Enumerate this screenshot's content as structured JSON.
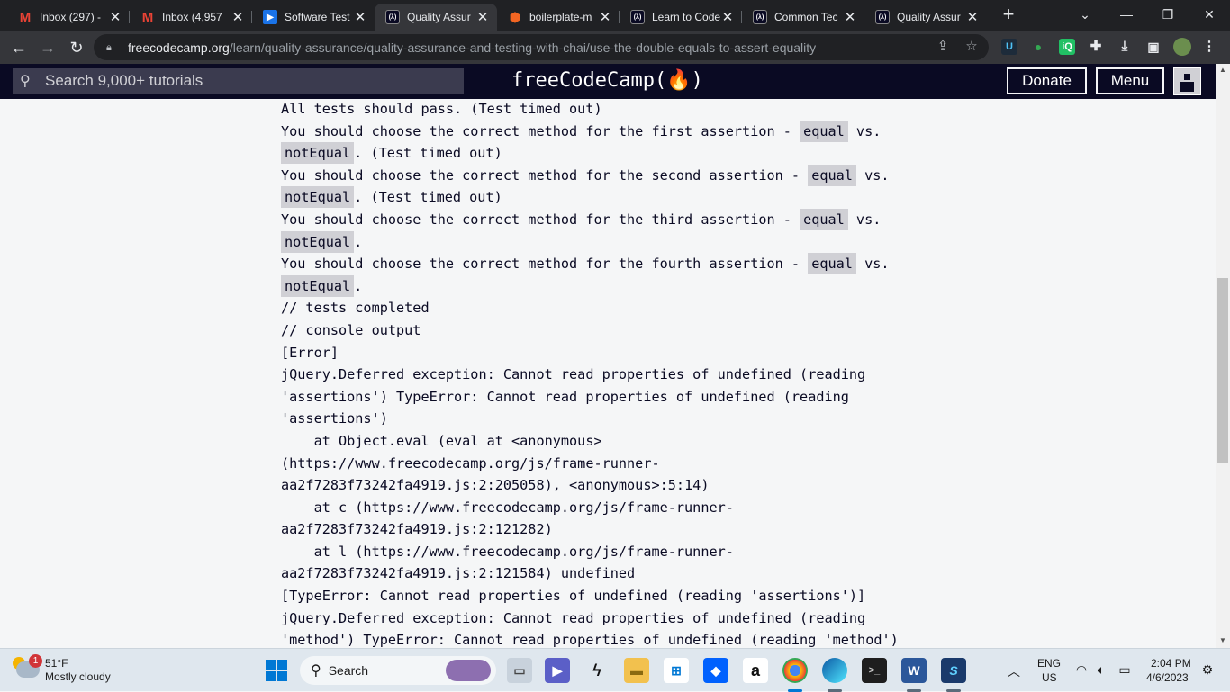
{
  "browser": {
    "tabs": [
      {
        "title": "Inbox (297) - ",
        "favicon": "gmail-icon",
        "active": false
      },
      {
        "title": "Inbox (4,957",
        "favicon": "gmail-icon",
        "active": false
      },
      {
        "title": "Software Test",
        "favicon": "youtube-icon",
        "active": false
      },
      {
        "title": "Quality Assur",
        "favicon": "freecodecamp-icon",
        "active": true
      },
      {
        "title": "boilerplate-m",
        "favicon": "boilerplate-icon",
        "active": false
      },
      {
        "title": "Learn to Code",
        "favicon": "freecodecamp-icon",
        "active": false
      },
      {
        "title": "Common Tec",
        "favicon": "freecodecamp-icon",
        "active": false
      },
      {
        "title": "Quality Assur",
        "favicon": "freecodecamp-icon",
        "active": false
      }
    ],
    "url_domain": "freecodecamp.org",
    "url_path": "/learn/quality-assurance/quality-assurance-and-testing-with-chai/use-the-double-equals-to-assert-equality"
  },
  "fcc_nav": {
    "search_placeholder": "Search 9,000+ tutorials",
    "logo": "freeCodeCamp(🔥)",
    "donate_label": "Donate",
    "menu_label": "Menu"
  },
  "console_lines": [
    {
      "text": "All tests should pass. (Test timed out)"
    },
    {
      "text": "You should choose the correct method for the first assertion - ",
      "code1": "equal",
      "tail": " vs."
    },
    {
      "code1": "notEqual",
      "tail": ". (Test timed out)"
    },
    {
      "text": "You should choose the correct method for the second assertion - ",
      "code1": "equal",
      "tail": " vs."
    },
    {
      "code1": "notEqual",
      "tail": ". (Test timed out)"
    },
    {
      "text": "You should choose the correct method for the third assertion - ",
      "code1": "equal",
      "tail": " vs."
    },
    {
      "code1": "notEqual",
      "tail": "."
    },
    {
      "text": "You should choose the correct method for the fourth assertion - ",
      "code1": "equal",
      "tail": " vs."
    },
    {
      "code1": "notEqual",
      "tail": "."
    },
    {
      "text": "// tests completed"
    },
    {
      "text": "// console output"
    },
    {
      "text": "[Error]"
    },
    {
      "text": "jQuery.Deferred exception: Cannot read properties of undefined (reading"
    },
    {
      "text": "'assertions') TypeError: Cannot read properties of undefined (reading"
    },
    {
      "text": "'assertions')"
    },
    {
      "text": "    at Object.eval (eval at <anonymous>"
    },
    {
      "text": "(https://www.freecodecamp.org/js/frame-runner-"
    },
    {
      "text": "aa2f7283f73242fa4919.js:2:205058), <anonymous>:5:14)"
    },
    {
      "text": "    at c (https://www.freecodecamp.org/js/frame-runner-"
    },
    {
      "text": "aa2f7283f73242fa4919.js:2:121282)"
    },
    {
      "text": "    at l (https://www.freecodecamp.org/js/frame-runner-"
    },
    {
      "text": "aa2f7283f73242fa4919.js:2:121584) undefined"
    },
    {
      "text": "[TypeError: Cannot read properties of undefined (reading 'assertions')]"
    },
    {
      "text": "jQuery.Deferred exception: Cannot read properties of undefined (reading"
    },
    {
      "text": "'method') TypeError: Cannot read properties of undefined (reading 'method')"
    }
  ],
  "taskbar": {
    "weather_temp": "51°F",
    "weather_condition": "Mostly cloudy",
    "weather_badge": "1",
    "search_label": "Search",
    "language": "ENG",
    "region": "US",
    "time": "2:04 PM",
    "date": "4/6/2023"
  }
}
